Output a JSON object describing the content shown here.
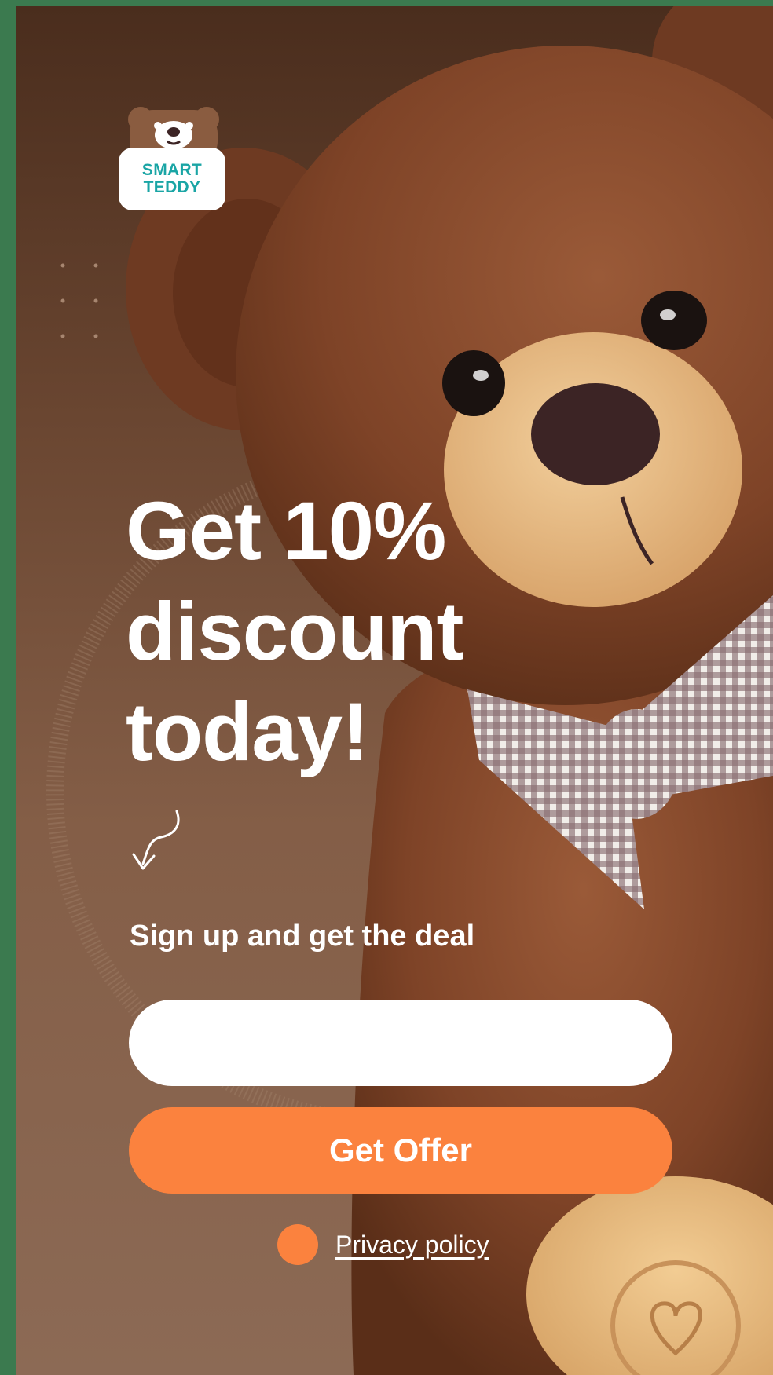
{
  "brand": {
    "line1": "SMART",
    "line2": "TEDDY"
  },
  "headline": {
    "line1": "Get 10%",
    "line2": "discount",
    "line3": "today!"
  },
  "subline": "Sign up and get the deal",
  "form": {
    "email_value": "",
    "email_placeholder": ""
  },
  "cta": {
    "label": "Get Offer"
  },
  "privacy": {
    "label": "Privacy policy"
  },
  "colors": {
    "accent": "#fb823e",
    "brand_teal": "#1aa5a5",
    "background_top": "#4a2d1d",
    "background_bottom": "#8c6a55",
    "outer_frame": "#3b7a4f"
  },
  "icons": [
    "bear-logo-icon",
    "curly-down-arrow-icon",
    "privacy-dot-icon"
  ]
}
